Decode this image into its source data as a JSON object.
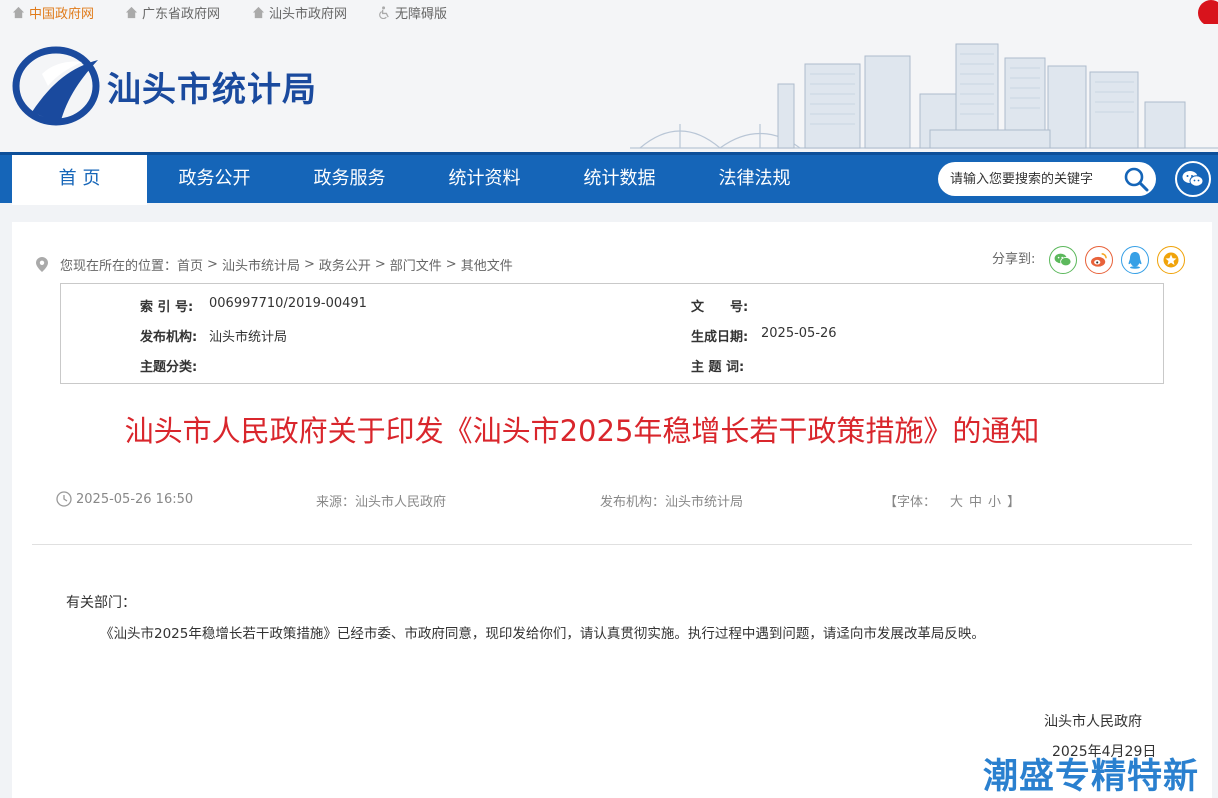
{
  "toplinks": [
    {
      "label": "中国政府网",
      "icon": "home-icon"
    },
    {
      "label": "广东省政府网",
      "icon": "home-icon"
    },
    {
      "label": "汕头市政府网",
      "icon": "home-icon"
    },
    {
      "label": "无障碍版",
      "icon": "accessibility-icon"
    }
  ],
  "header": {
    "site_name": "汕头市统计局"
  },
  "nav": {
    "items": [
      "首 页",
      "政务公开",
      "政务服务",
      "统计资料",
      "统计数据",
      "法律法规"
    ],
    "active_index": 0,
    "search_placeholder": "请输入您要搜索的关键字"
  },
  "breadcrumb": {
    "prefix": "您现在所在的位置：",
    "items": [
      "首页",
      "汕头市统计局",
      "政务公开",
      "部门文件",
      "其他文件"
    ],
    "separator": ">"
  },
  "share": {
    "label": "分享到:",
    "targets": [
      "wechat-icon",
      "weibo-icon",
      "qq-icon",
      "favorite-icon"
    ]
  },
  "meta": {
    "index_label": "索 引 号:",
    "index_value": "006997710/2019-00491",
    "doc_no_label": "文　　号:",
    "doc_no_value": "",
    "publisher_label": "发布机构:",
    "publisher_value": "汕头市统计局",
    "gen_date_label": "生成日期:",
    "gen_date_value": "2025-05-26",
    "topic_label": "主题分类:",
    "topic_value": "",
    "keywords_label": "主 题 词:",
    "keywords_value": ""
  },
  "article": {
    "title": "汕头市人民政府关于印发《汕头市2025年稳增长若干政策措施》的通知",
    "datetime": "2025-05-26 16:50",
    "source": "来源：汕头市人民政府",
    "publisher": "发布机构：汕头市统计局",
    "font_label": "【字体：",
    "font_sizes": [
      "大",
      "中",
      "小"
    ],
    "font_end": "】",
    "salutation": "有关部门：",
    "paragraph": "《汕头市2025年稳增长若干政策措施》已经市委、市政府同意，现印发给你们，请认真贯彻实施。执行过程中遇到问题，请迳向市发展改革局反映。",
    "signature": "汕头市人民政府",
    "sign_date": "2025年4月29日"
  },
  "watermark": "潮盛专精特新",
  "colors": {
    "nav": "#1565b8",
    "title": "#d9262c",
    "accent": "#e07b1a"
  }
}
